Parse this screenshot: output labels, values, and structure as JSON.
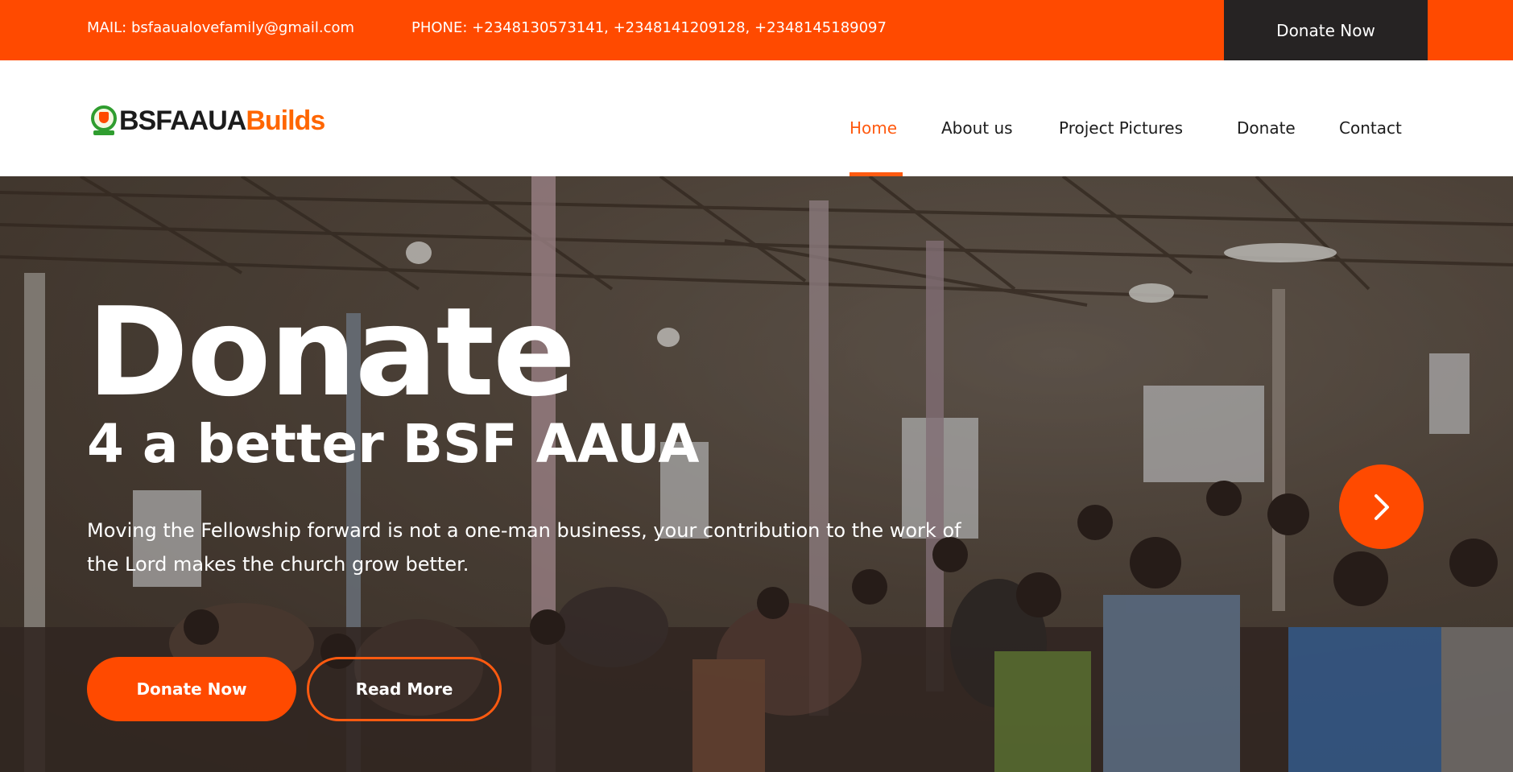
{
  "topbar": {
    "mail": "MAIL: bsfaaualovefamily@gmail.com",
    "phone": "PHONE: +2348130573141, +2348141209128, +2348145189097",
    "donate_label": "Donate Now"
  },
  "brand": {
    "logo_part1": "BSFAAUA",
    "logo_part2": "Builds"
  },
  "nav": {
    "items": [
      {
        "label": "Home",
        "active": true
      },
      {
        "label": "About us",
        "active": false
      },
      {
        "label": "Project Pictures",
        "active": false
      },
      {
        "label": "Donate",
        "active": false
      },
      {
        "label": "Contact",
        "active": false
      }
    ]
  },
  "hero": {
    "title": "Donate",
    "subtitle": "4 a better BSF AAUA",
    "description": "Moving the Fellowship forward is not a one-man business, your contribution to the work of the Lord makes the church grow better.",
    "primary_button": "Donate Now",
    "secondary_button": "Read More",
    "next_icon": "chevron-right-icon"
  },
  "colors": {
    "accent": "#ff4a00",
    "dark": "#262323",
    "nav_text": "#1c1c1c"
  }
}
